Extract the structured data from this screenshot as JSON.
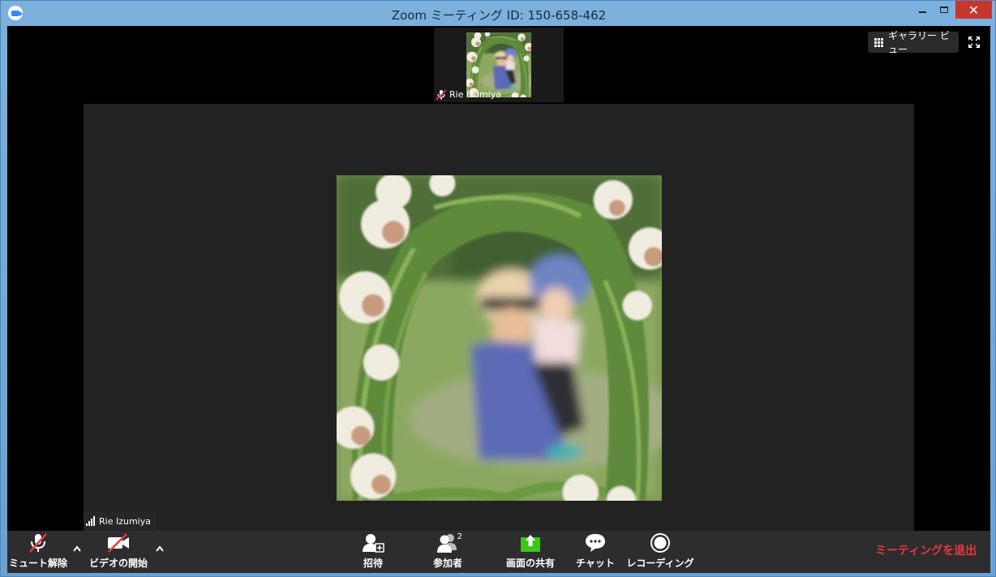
{
  "window": {
    "title": "Zoom ミーティング ID: 150-658-462",
    "close_glyph": "✕"
  },
  "thumbnail": {
    "participant_name": "Rie Izumiya",
    "mic_icon": "mic-muted-icon"
  },
  "top_controls": {
    "gallery_view_label": "ギャラリー ビュー",
    "fullscreen_icon": "fullscreen-icon"
  },
  "main_video": {
    "participant_name": "Rie Izumiya",
    "signal_icon": "signal-strength-icon"
  },
  "toolbar": {
    "mute_label": "ミュート解除",
    "video_label": "ビデオの開始",
    "invite_label": "招待",
    "participants_label": "参加者",
    "participants_count": "2",
    "share_label": "画面の共有",
    "chat_label": "チャット",
    "record_label": "レコーディング",
    "leave_label": "ミーティングを退出"
  },
  "colors": {
    "share_green": "#3ec51a",
    "leave_red": "#e8383d",
    "muted_red": "#e8383d"
  }
}
